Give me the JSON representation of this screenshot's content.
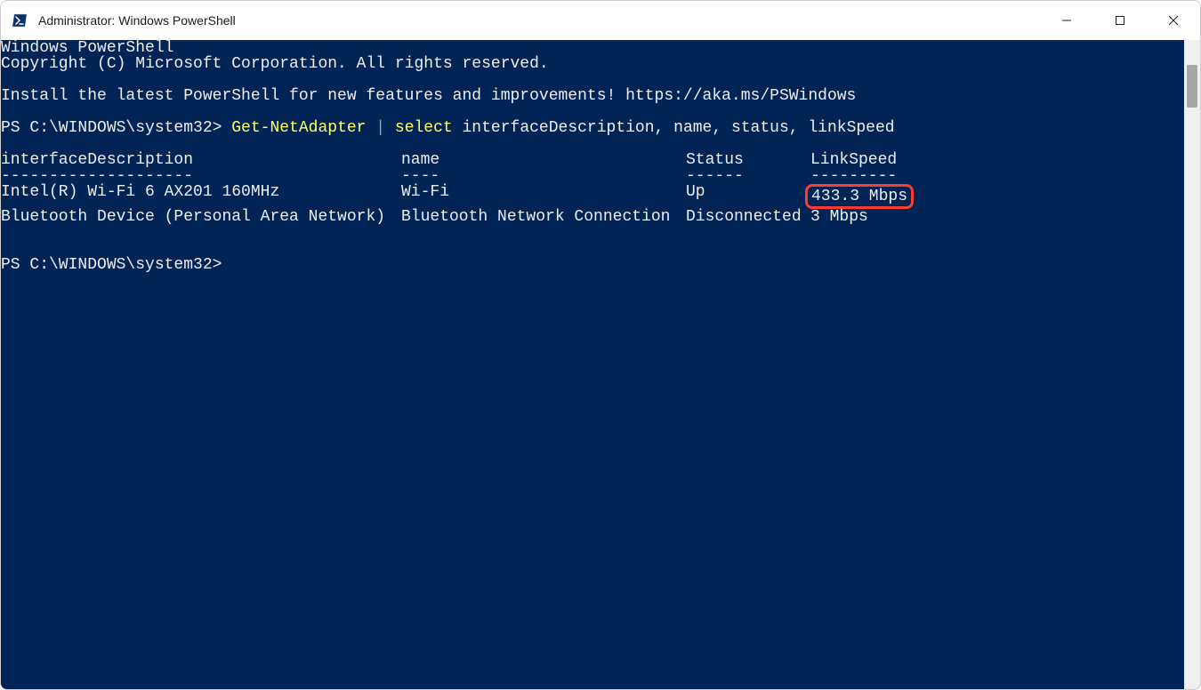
{
  "window": {
    "title": "Administrator: Windows PowerShell"
  },
  "terminal": {
    "banner_line1": "Windows PowerShell",
    "banner_line2": "Copyright (C) Microsoft Corporation. All rights reserved.",
    "install_msg": "Install the latest PowerShell for new features and improvements! https://aka.ms/PSWindows",
    "prompt1": "PS C:\\WINDOWS\\system32> ",
    "cmd_part1": "Get-NetAdapter",
    "cmd_pipe": " | ",
    "cmd_part2": "select",
    "cmd_args": " interfaceDescription, name, status, linkSpeed",
    "headers": {
      "desc": "interfaceDescription",
      "name": "name",
      "status": "Status",
      "speed": "LinkSpeed"
    },
    "underlines": {
      "desc": "--------------------",
      "name": "----",
      "status": "------",
      "speed": "---------"
    },
    "rows": [
      {
        "desc": "Intel(R) Wi-Fi 6 AX201 160MHz",
        "name": "Wi-Fi",
        "status": "Up",
        "speed": "433.3 Mbps",
        "highlight_speed": true
      },
      {
        "desc": "Bluetooth Device (Personal Area Network)",
        "name": "Bluetooth Network Connection",
        "status": "Disconnected",
        "speed": "3 Mbps",
        "highlight_speed": false
      }
    ],
    "prompt2": "PS C:\\WINDOWS\\system32>"
  }
}
